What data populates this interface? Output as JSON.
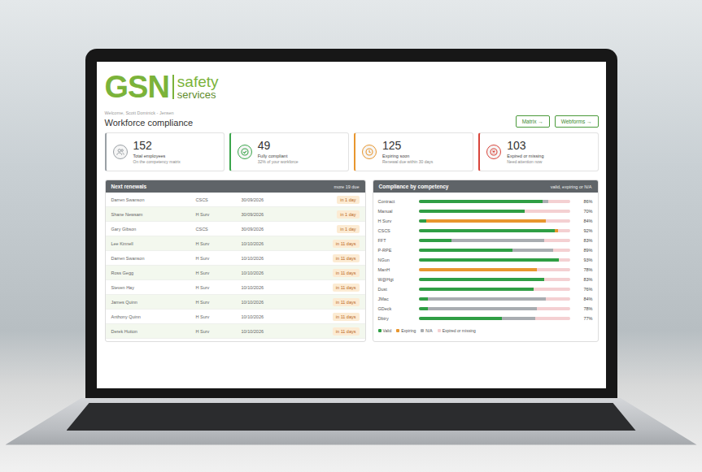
{
  "logo": {
    "mark": "GSN",
    "line1": "safety",
    "line2": "services"
  },
  "welcome": "Welcome, Scott Dominick - Jensen",
  "title": "Workforce compliance",
  "buttons": [
    {
      "label": "Matrix →"
    },
    {
      "label": "Webforms →"
    }
  ],
  "stats": [
    {
      "value": "152",
      "label": "Total employees",
      "note": "On the competency matrix",
      "color": "#9aa0a5",
      "kind": "people"
    },
    {
      "value": "49",
      "label": "Fully compliant",
      "note": "32% of your workforce",
      "color": "#3aa54b",
      "kind": "check"
    },
    {
      "value": "125",
      "label": "Expiring soon",
      "note": "Renewal due within 30 days",
      "color": "#e8962e",
      "kind": "clock"
    },
    {
      "value": "103",
      "label": "Expired or missing",
      "note": "Need attention now",
      "color": "#d9443a",
      "kind": "cross"
    }
  ],
  "renewals": {
    "title": "Next renewals",
    "count": "more 19 due",
    "rows": [
      {
        "name": "Darren Swanson",
        "competency": "CSCS",
        "date": "30/09/2026",
        "due": "in 1 day"
      },
      {
        "name": "Shane Newsam",
        "competency": "H Surv",
        "date": "30/09/2026",
        "due": "in 1 day"
      },
      {
        "name": "Gary Gibson",
        "competency": "CSCS",
        "date": "30/09/2026",
        "due": "in 1 day"
      },
      {
        "name": "Lee Kinnell",
        "competency": "H Surv",
        "date": "10/10/2026",
        "due": "in 11 days"
      },
      {
        "name": "Darren Swanson",
        "competency": "H Surv",
        "date": "10/10/2026",
        "due": "in 11 days"
      },
      {
        "name": "Ross Gegg",
        "competency": "H Surv",
        "date": "10/10/2026",
        "due": "in 11 days"
      },
      {
        "name": "Steven Hay",
        "competency": "H Surv",
        "date": "10/10/2026",
        "due": "in 11 days"
      },
      {
        "name": "James Quinn",
        "competency": "H Surv",
        "date": "10/10/2026",
        "due": "in 11 days"
      },
      {
        "name": "Anthony Quinn",
        "competency": "H Surv",
        "date": "10/10/2026",
        "due": "in 11 days"
      },
      {
        "name": "Derek Hutton",
        "competency": "H Surv",
        "date": "10/10/2026",
        "due": "in 11 days"
      }
    ]
  },
  "compliance": {
    "title": "Compliance by competency",
    "subtitle": "valid, expiring or N/A",
    "legend": [
      {
        "kind": "valid",
        "label": "Valid",
        "color": "#2f9e44"
      },
      {
        "kind": "expiring",
        "label": "Expiring",
        "color": "#e8962e"
      },
      {
        "kind": "na",
        "label": "N/A",
        "color": "#a9adb1"
      },
      {
        "kind": "expired",
        "label": "Expired or missing",
        "color": "#f4d0d2"
      }
    ],
    "rows": [
      {
        "label": "Contract",
        "percent": "86%",
        "segments": [
          {
            "kind": "valid",
            "level": 0.82
          },
          {
            "kind": "na",
            "level": 0.04
          },
          {
            "kind": "expired",
            "level": 0.14
          }
        ]
      },
      {
        "label": "Manual",
        "percent": "70%",
        "segments": [
          {
            "kind": "valid",
            "level": 0.7
          },
          {
            "kind": "expired",
            "level": 0.3
          }
        ]
      },
      {
        "label": "H Surv",
        "percent": "84%",
        "segments": [
          {
            "kind": "valid",
            "level": 0.05
          },
          {
            "kind": "expiring",
            "level": 0.79
          },
          {
            "kind": "expired",
            "level": 0.16
          }
        ]
      },
      {
        "label": "CSCS",
        "percent": "92%",
        "segments": [
          {
            "kind": "valid",
            "level": 0.9
          },
          {
            "kind": "expiring",
            "level": 0.02
          },
          {
            "kind": "expired",
            "level": 0.08
          }
        ]
      },
      {
        "label": "FFT",
        "percent": "83%",
        "segments": [
          {
            "kind": "valid",
            "level": 0.22
          },
          {
            "kind": "na",
            "level": 0.61
          },
          {
            "kind": "expired",
            "level": 0.17
          }
        ]
      },
      {
        "label": "P-RPE",
        "percent": "89%",
        "segments": [
          {
            "kind": "valid",
            "level": 0.62
          },
          {
            "kind": "na",
            "level": 0.27
          },
          {
            "kind": "expired",
            "level": 0.11
          }
        ]
      },
      {
        "label": "NGun",
        "percent": "93%",
        "segments": [
          {
            "kind": "valid",
            "level": 0.93
          },
          {
            "kind": "expired",
            "level": 0.07
          }
        ]
      },
      {
        "label": "ManH",
        "percent": "78%",
        "segments": [
          {
            "kind": "expiring",
            "level": 0.78
          },
          {
            "kind": "expired",
            "level": 0.22
          }
        ]
      },
      {
        "label": "W@Hgt",
        "percent": "83%",
        "segments": [
          {
            "kind": "valid",
            "level": 0.83
          },
          {
            "kind": "expired",
            "level": 0.17
          }
        ]
      },
      {
        "label": "Dust",
        "percent": "76%",
        "segments": [
          {
            "kind": "valid",
            "level": 0.76
          },
          {
            "kind": "expired",
            "level": 0.24
          }
        ]
      },
      {
        "label": "JMac",
        "percent": "84%",
        "segments": [
          {
            "kind": "valid",
            "level": 0.06
          },
          {
            "kind": "na",
            "level": 0.78
          },
          {
            "kind": "expired",
            "level": 0.16
          }
        ]
      },
      {
        "label": "GDeck",
        "percent": "78%",
        "segments": [
          {
            "kind": "valid",
            "level": 0.06
          },
          {
            "kind": "na",
            "level": 0.72
          },
          {
            "kind": "expired",
            "level": 0.22
          }
        ]
      },
      {
        "label": "Dbtry",
        "percent": "77%",
        "segments": [
          {
            "kind": "valid",
            "level": 0.55
          },
          {
            "kind": "na",
            "level": 0.22
          },
          {
            "kind": "expired",
            "level": 0.23
          }
        ]
      }
    ]
  }
}
